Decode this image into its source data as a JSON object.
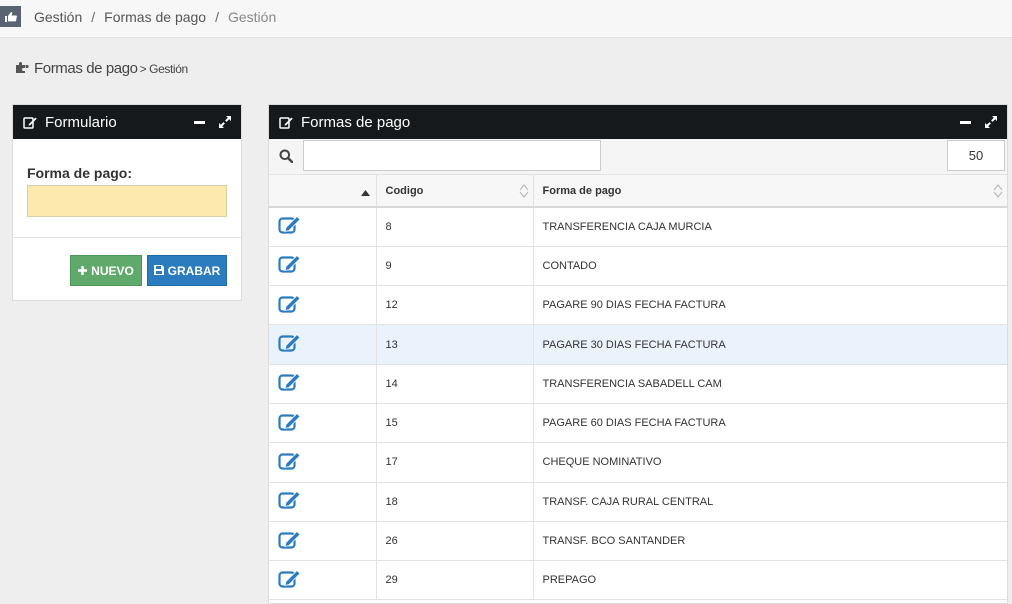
{
  "breadcrumb": {
    "items": [
      "Gestión",
      "Formas de pago"
    ],
    "current": "Gestión",
    "separator": "/"
  },
  "page_title": {
    "main": "Formas de pago",
    "sub": "> Gestión"
  },
  "form_panel": {
    "title": "Formulario",
    "field_label": "Forma de pago:",
    "field_value": "",
    "new_label": "NUEVO",
    "save_label": "GRABAR"
  },
  "list_panel": {
    "title": "Formas de pago",
    "search_value": "",
    "page_size": "50",
    "columns": [
      "",
      "Codigo",
      "Forma de pago"
    ],
    "rows": [
      {
        "codigo": "8",
        "forma": "TRANSFERENCIA CAJA MURCIA"
      },
      {
        "codigo": "9",
        "forma": "CONTADO"
      },
      {
        "codigo": "12",
        "forma": "PAGARE 90 DIAS FECHA FACTURA"
      },
      {
        "codigo": "13",
        "forma": "PAGARE 30 DIAS FECHA FACTURA"
      },
      {
        "codigo": "14",
        "forma": "TRANSFERENCIA SABADELL CAM"
      },
      {
        "codigo": "15",
        "forma": "PAGARE 60 DIAS FECHA FACTURA"
      },
      {
        "codigo": "17",
        "forma": "CHEQUE NOMINATIVO"
      },
      {
        "codigo": "18",
        "forma": "TRANSF. CAJA RURAL CENTRAL"
      },
      {
        "codigo": "26",
        "forma": "TRANSF. BCO SANTANDER"
      },
      {
        "codigo": "29",
        "forma": "PREPAGO"
      }
    ],
    "highlighted_row_index": 3
  },
  "colors": {
    "panel_header": "#15191c",
    "input_highlight": "#fde9ae",
    "btn_new": "#5fa96a",
    "btn_save": "#2a7cbf",
    "edit_icon": "#2a7cbf",
    "row_highlight": "#eaf3fb"
  },
  "icons": {
    "home": "hand-point-icon",
    "title": "puzzle-icon",
    "panel": "edit-icon",
    "minimize": "minus-icon",
    "maximize": "expand-icon",
    "search": "search-icon",
    "new": "plus-icon",
    "save": "floppy-icon",
    "row_edit": "edit-icon"
  }
}
